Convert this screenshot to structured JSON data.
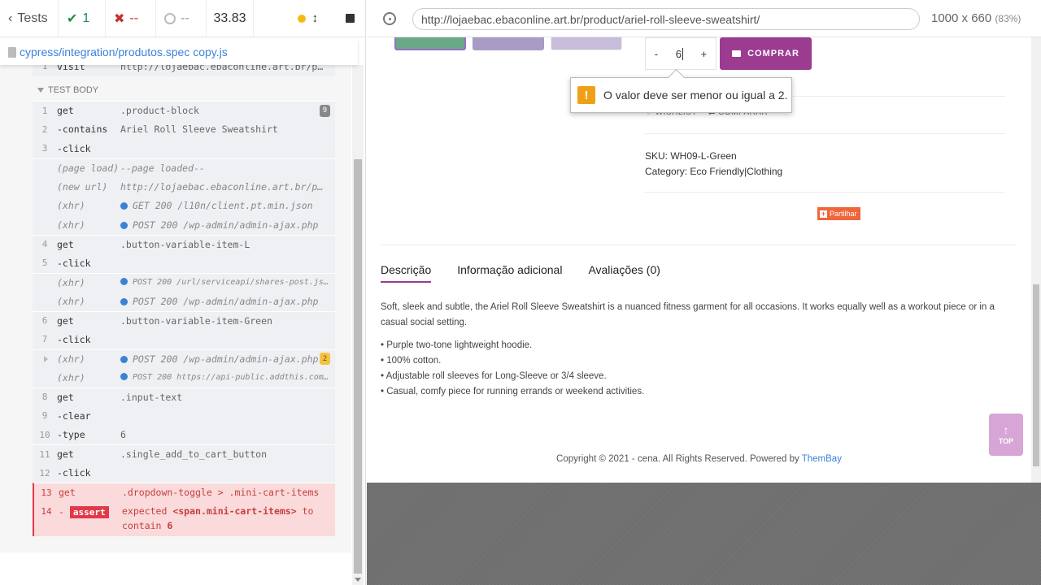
{
  "reporter": {
    "tests_label": "Tests",
    "passed": "1",
    "failed": "--",
    "pending": "--",
    "duration": "33.83",
    "spec_path": "cypress/integration/produtos.spec copy.js",
    "visit_row": {
      "num": "1",
      "cmd": "visit",
      "msg": "http://lojaebac.ebaconline.art.br/pro…"
    },
    "test_body_label": "TEST BODY",
    "commands": [
      {
        "num": "1",
        "cmd": "get",
        "msg": ".product-block",
        "badge": "9"
      },
      {
        "num": "2",
        "cmd": "-contains",
        "msg": "Ariel Roll Sleeve Sweatshirt"
      },
      {
        "num": "3",
        "cmd": "-click",
        "msg": ""
      },
      {
        "num": "",
        "cmd": "(page load)",
        "msg": "--page loaded--",
        "event": true
      },
      {
        "num": "",
        "cmd": "(new url)",
        "msg": "http://lojaebac.ebaconline.art.br/pro…",
        "event": true
      },
      {
        "num": "",
        "cmd": "(xhr)",
        "msg": "GET 200 /l10n/client.pt.min.json",
        "event": true,
        "dot": true
      },
      {
        "num": "",
        "cmd": "(xhr)",
        "msg": "POST 200 /wp-admin/admin-ajax.php",
        "event": true,
        "dot": true
      },
      {
        "num": "4",
        "cmd": "get",
        "msg": ".button-variable-item-L"
      },
      {
        "num": "5",
        "cmd": "-click",
        "msg": ""
      },
      {
        "num": "",
        "cmd": "(xhr)",
        "msg": "POST 200 /url/serviceapi/shares-post.json…",
        "event": true,
        "dot": true,
        "small": true
      },
      {
        "num": "",
        "cmd": "(xhr)",
        "msg": "POST 200 /wp-admin/admin-ajax.php",
        "event": true,
        "dot": true
      },
      {
        "num": "6",
        "cmd": "get",
        "msg": ".button-variable-item-Green"
      },
      {
        "num": "7",
        "cmd": "-click",
        "msg": ""
      },
      {
        "num": "",
        "cmd": "(xhr)",
        "msg": "POST 200 /wp-admin/admin-ajax.php",
        "event": true,
        "dot": true,
        "badge": "2",
        "caret": true
      },
      {
        "num": "",
        "cmd": "(xhr)",
        "msg": "POST 200 https://api-public.addthis.com/u…",
        "event": true,
        "dot": true,
        "small": true
      },
      {
        "num": "8",
        "cmd": "get",
        "msg": ".input-text"
      },
      {
        "num": "9",
        "cmd": "-clear",
        "msg": ""
      },
      {
        "num": "10",
        "cmd": "-type",
        "msg": "6"
      },
      {
        "num": "11",
        "cmd": "get",
        "msg": ".single_add_to_cart_button"
      },
      {
        "num": "12",
        "cmd": "-click",
        "msg": ""
      },
      {
        "num": "13",
        "cmd": "get",
        "msg": ".dropdown-toggle > .mini-cart-items",
        "error": true
      }
    ],
    "assert_row": {
      "num": "14",
      "dash": "-",
      "tag": "assert",
      "word1": "expected",
      "subject": "<span.mini-cart-items>",
      "word2": "to",
      "word3": "contain",
      "value": "6"
    }
  },
  "browser": {
    "url": "http://lojaebac.ebaconline.art.br/product/ariel-roll-sleeve-sweatshirt/",
    "viewport": "1000 x 660",
    "zoom": "(83%)"
  },
  "product": {
    "qty_minus": "-",
    "qty_value": "6",
    "qty_plus": "+",
    "buy_label": "COMPRAR",
    "tooltip_icon": "!",
    "tooltip_text": "O valor deve ser menor ou igual a 2.",
    "wishlist": "♡ WISHLIST",
    "compare": "COMPARAR",
    "sku_label": "SKU:",
    "sku_value": "WH09-L-Green",
    "category_label": "Category:",
    "category_value": "Eco Friendly|Clothing",
    "share_label": "Partilhar",
    "tabs": [
      "Descrição",
      "Informação adicional",
      "Avaliações (0)"
    ],
    "description": "Soft, sleek and subtle, the Ariel Roll Sleeve Sweatshirt is a nuanced fitness garment for all occasions. It works equally well as a workout piece or in a casual social setting.",
    "bullets": [
      "Purple two-tone lightweight hoodie.",
      "100% cotton.",
      "Adjustable roll sleeves for Long-Sleeve or 3/4 sleeve.",
      "Casual, comfy piece for running errands or weekend activities."
    ],
    "top_label": "TOP",
    "footer_text": "Copyright © 2021 - cena. All Rights Reserved. Powered by",
    "footer_brand": "ThemBay"
  },
  "colors": {
    "accent": "#9b3c90",
    "pass": "#1e8c4c",
    "fail": "#c9302c",
    "error_bg": "#fadada"
  }
}
